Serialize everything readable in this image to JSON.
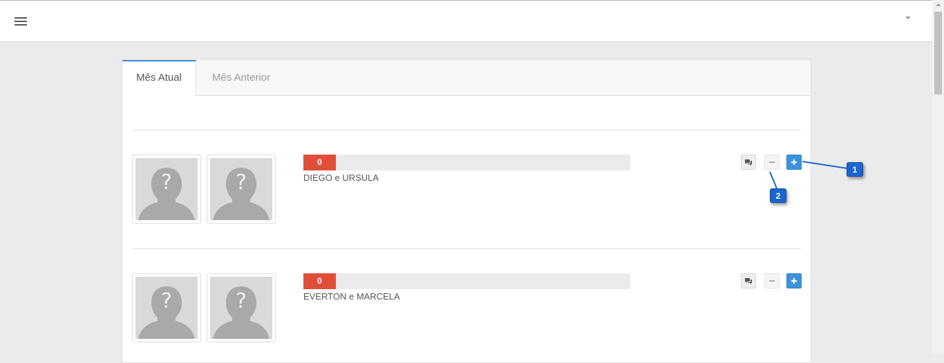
{
  "header": {
    "menu_icon": "hamburger-icon",
    "dropdown_icon": "caret-down-icon"
  },
  "tabs": [
    {
      "label": "Mês Atual",
      "active": true
    },
    {
      "label": "Mês Anterior",
      "active": false
    }
  ],
  "couples": [
    {
      "name": "DIEGO e URSULA",
      "score": "0",
      "avatar_icon": "unknown-person-icon"
    },
    {
      "name": "EVERTON e MARCELA",
      "score": "0",
      "avatar_icon": "unknown-person-icon"
    }
  ],
  "actions": {
    "comment_icon": "comments-icon",
    "minus_icon": "minus-icon",
    "plus_icon": "plus-icon"
  },
  "callouts": [
    {
      "number": "1",
      "target": "plus-button"
    },
    {
      "number": "2",
      "target": "minus-button"
    }
  ],
  "colors": {
    "accent_blue": "#3d93db",
    "progress_red": "#e04e39",
    "callout_blue": "#1b66cc"
  }
}
